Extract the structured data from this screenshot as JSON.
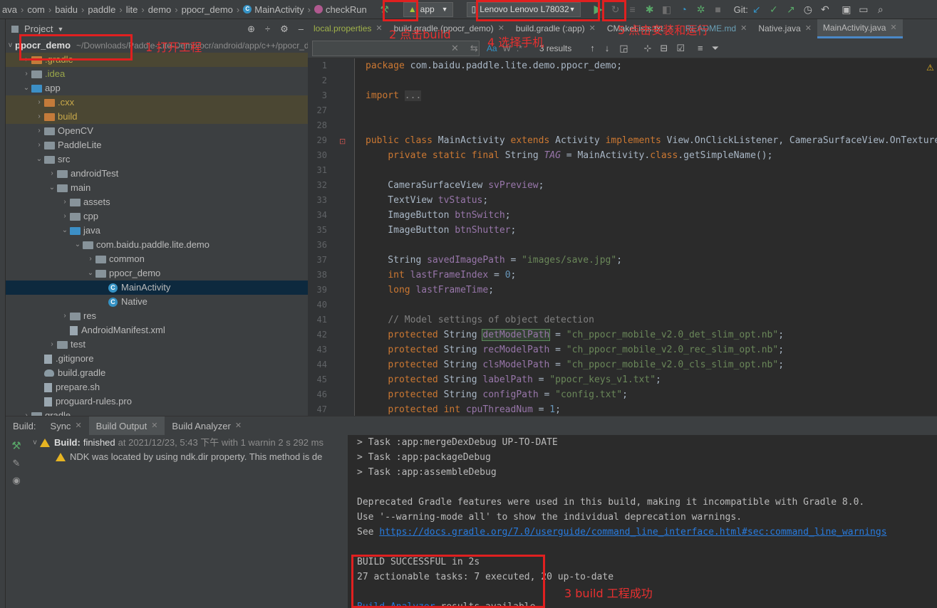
{
  "breadcrumbs": [
    "ava",
    "com",
    "baidu",
    "paddle",
    "lite",
    "demo",
    "ppocr_demo",
    "MainActivity",
    "checkRun"
  ],
  "toolbar": {
    "module": "app",
    "device": "Lenovo Lenovo L78032",
    "git_label": "Git:"
  },
  "project": {
    "header": "Project",
    "root_name": "ppocr_demo",
    "root_path": "~/Downloads/Paddle-Lite-Demo/ocr/android/app/c++/ppocr_demo"
  },
  "tree": [
    {
      "label": ".gradle",
      "indent": 1,
      "type": "folder-orange",
      "arrow": ">",
      "hl": true
    },
    {
      "label": ".idea",
      "indent": 1,
      "type": "folder",
      "arrow": ">"
    },
    {
      "label": "app",
      "indent": 1,
      "type": "folder-blue",
      "arrow": "v"
    },
    {
      "label": ".cxx",
      "indent": 2,
      "type": "folder-orange",
      "arrow": ">",
      "hl": true
    },
    {
      "label": "build",
      "indent": 2,
      "type": "folder-orange",
      "arrow": ">",
      "hl": true
    },
    {
      "label": "OpenCV",
      "indent": 2,
      "type": "folder",
      "arrow": ">"
    },
    {
      "label": "PaddleLite",
      "indent": 2,
      "type": "folder",
      "arrow": ">"
    },
    {
      "label": "src",
      "indent": 2,
      "type": "folder",
      "arrow": "v"
    },
    {
      "label": "androidTest",
      "indent": 3,
      "type": "folder",
      "arrow": ">"
    },
    {
      "label": "main",
      "indent": 3,
      "type": "folder",
      "arrow": "v"
    },
    {
      "label": "assets",
      "indent": 4,
      "type": "folder",
      "arrow": ">"
    },
    {
      "label": "cpp",
      "indent": 4,
      "type": "folder",
      "arrow": ">"
    },
    {
      "label": "java",
      "indent": 4,
      "type": "folder-blue",
      "arrow": "v"
    },
    {
      "label": "com.baidu.paddle.lite.demo",
      "indent": 5,
      "type": "folder",
      "arrow": "v"
    },
    {
      "label": "common",
      "indent": 6,
      "type": "folder",
      "arrow": ">"
    },
    {
      "label": "ppocr_demo",
      "indent": 6,
      "type": "folder",
      "arrow": "v"
    },
    {
      "label": "MainActivity",
      "indent": 7,
      "type": "class",
      "arrow": "",
      "selected": true
    },
    {
      "label": "Native",
      "indent": 7,
      "type": "class",
      "arrow": ""
    },
    {
      "label": "res",
      "indent": 4,
      "type": "folder",
      "arrow": ">"
    },
    {
      "label": "AndroidManifest.xml",
      "indent": 4,
      "type": "file",
      "arrow": ""
    },
    {
      "label": "test",
      "indent": 3,
      "type": "folder",
      "arrow": ">"
    },
    {
      "label": ".gitignore",
      "indent": 2,
      "type": "file",
      "arrow": ""
    },
    {
      "label": "build.gradle",
      "indent": 2,
      "type": "gradle",
      "arrow": ""
    },
    {
      "label": "prepare.sh",
      "indent": 2,
      "type": "file",
      "arrow": ""
    },
    {
      "label": "proguard-rules.pro",
      "indent": 2,
      "type": "file",
      "arrow": ""
    },
    {
      "label": "gradle",
      "indent": 1,
      "type": "folder",
      "arrow": ">"
    }
  ],
  "tabs": [
    {
      "label": "local.properties",
      "color": "#a0b24a"
    },
    {
      "label": "build.gradle (ppocr_demo)",
      "color": "#bbbbbb"
    },
    {
      "label": "build.gradle (:app)",
      "color": "#bbbbbb"
    },
    {
      "label": "CMakeLists.txt",
      "color": "#bbbbbb"
    },
    {
      "label": "README.md",
      "color": "#6a9fb5"
    },
    {
      "label": "Native.java",
      "color": "#bbbbbb"
    },
    {
      "label": "MainActivity.java",
      "color": "#bbbbbb",
      "active": true
    }
  ],
  "find": {
    "results": "3 results",
    "aa": "Aa",
    "w": "W"
  },
  "line_numbers": [
    "1",
    "2",
    "3",
    "27",
    "28",
    "29",
    "30",
    "31",
    "32",
    "33",
    "34",
    "35",
    "36",
    "37",
    "38",
    "39",
    "40",
    "41",
    "42",
    "43",
    "44",
    "45",
    "46",
    "47"
  ],
  "build": {
    "label": "Build:",
    "tabs": [
      "Sync",
      "Build Output",
      "Build Analyzer"
    ],
    "status_prefix": "Build:",
    "status_text": "finished",
    "status_time": "at 2021/12/23, 5:43 下午 with 1 warnin 2 s 292 ms",
    "warning": "NDK was located by using ndk.dir property. This method is de"
  },
  "output": {
    "lines": [
      "> Task :app:mergeDexDebug UP-TO-DATE",
      "> Task :app:packageDebug",
      "> Task :app:assembleDebug",
      "",
      "Deprecated Gradle features were used in this build, making it incompatible with Gradle 8.0.",
      "Use '--warning-mode all' to show the individual deprecation warnings."
    ],
    "see_prefix": "See ",
    "link": "https://docs.gradle.org/7.0/userguide/command_line_interface.html#sec:command_line_warnings",
    "success": "BUILD SUCCESSFUL in 2s",
    "tasks": "27 actionable tasks: 7 executed, 20 up-to-date",
    "analyzer_link": "Build Analyzer",
    "analyzer_rest": " results available"
  },
  "annotations": {
    "a1": "1 打开工程",
    "a2": "2 点击build",
    "a3": "3 build 工程成功",
    "a4": "4 选择手机",
    "a5": "5 点击安装和运行"
  },
  "colors": {
    "annotation": "#e02020",
    "selection": "#0d293e",
    "link": "#287bde"
  }
}
